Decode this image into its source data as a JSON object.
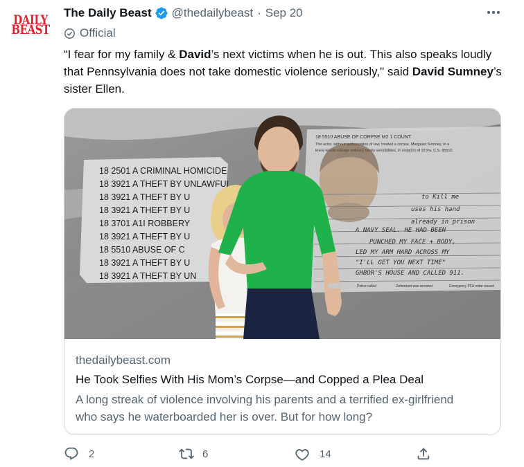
{
  "tweet": {
    "author_name": "The Daily Beast",
    "handle": "@thedailybeast",
    "separator": "·",
    "date": "Sep 20",
    "official_label": "Official",
    "avatar_lines": [
      "DAILY",
      "BEAST"
    ],
    "text": {
      "part1": "“I fear for my family & ",
      "bold1": "David",
      "part2": "’s next victims when he is out. This also speaks loudly that Pennsylvania does not take domestic violence seriously,\" said ",
      "bold2": "David Sumney",
      "part3": "’s sister Ellen."
    },
    "card": {
      "domain": "thedailybeast.com",
      "title": "He Took Selfies With His Mom’s Corpse—and Copped a Plea Deal",
      "description": "A long streak of violence involving his parents and a terrified ex-girlfriend who says he waterboarded her is over. But for how long?",
      "image": {
        "charges": [
          "18 2501 A CRIMINAL HOMICIDE",
          "18 3921 A THEFT BY UNLAWFUL",
          "18 3921 A THEFT BY U",
          "18 3921 A THEFT BY U",
          "18 3701 A1I ROBBERY",
          "18 3921 A THEFT BY U",
          "18 5510  ABUSE OF C",
          "18 3921 A THEFT BY U",
          "18 3921 A THEFT BY UN"
        ],
        "doc_header": "18 5510 ABUSE OF CORPSE M2    1 COUNT",
        "doc_line1": "The actor, without authorization of law, treated a corpse, Margaret Sumney, in a",
        "doc_line2": "knew would outrage ordinary family sensibilities, in violation of 18 Pa. C.S. §5510.",
        "handwriting": [
          "to  Kill  me",
          "uses  his  hand",
          "already  in  prison",
          "A NAVY  SEAL.  HE  HAD BEEN",
          "PUNCHED  MY  FACE + BODY,",
          "LED  MY  ARM  HARD  ACROSS  MY",
          "\"I'LL  GET  YOU  NEXT  TIME\"",
          "GHBOR'S HOUSE  AND  CALLED  911."
        ],
        "checkbox_labels": [
          "Police called",
          "Defendant was arrested",
          "Emergency PFA order issued"
        ]
      }
    },
    "actions": {
      "replies": "2",
      "retweets": "6",
      "likes": "14"
    },
    "colors": {
      "verified": "#1d9bf0",
      "brand_red": "#e0242d",
      "secondary_text": "#536471",
      "border": "#cfd9de"
    }
  }
}
